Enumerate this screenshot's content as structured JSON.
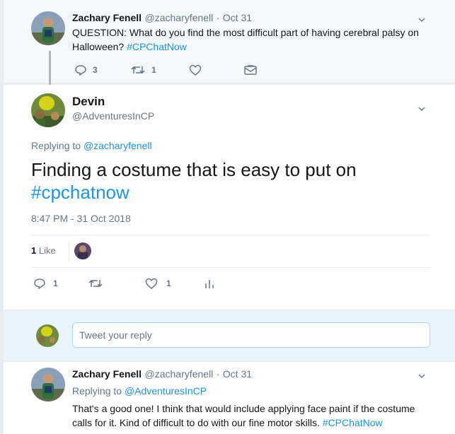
{
  "tweet1": {
    "name": "Zachary Fenell",
    "handle": "@zacharyfenell",
    "dot": "·",
    "date": "Oct 31",
    "text_line1": "QUESTION: What do you find the most difficult part of having cerebral palsy on",
    "text_line2": "Halloween?",
    "hashtag": "#CPChatNow",
    "reply_count": "3",
    "retweet_count": "1"
  },
  "tweet2": {
    "name": "Devin",
    "handle": "@AdventuresInCP",
    "replying_to_label": "Replying to",
    "replying_to_handle": "@zacharyfenell",
    "text_line1": "Finding a costume that is easy to put on",
    "hashtag": "#cpchatnow",
    "timestamp": "8:47 PM - 31 Oct 2018",
    "likes_count": "1",
    "likes_label": "Like",
    "reply_count": "1",
    "like_count": "1"
  },
  "reply_box": {
    "placeholder": "Tweet your reply"
  },
  "tweet3": {
    "name": "Zachary Fenell",
    "handle": "@zacharyfenell",
    "dot": "·",
    "date": "Oct 31",
    "replying_to_label": "Replying to",
    "replying_to_handle": "@AdventuresInCP",
    "text_line1": "That's a good one! I think that would include applying face paint if the costume",
    "text_line2": "calls for it. Kind of difficult to do with our fine motor skills.",
    "hashtag": "#CPChatNow"
  },
  "colors": {
    "link": "#1b95e0",
    "muted": "#657786",
    "text": "#14171a",
    "like_red": "#e0245e"
  },
  "icons": [
    "chevron-down-icon",
    "reply-icon",
    "retweet-icon",
    "heart-icon",
    "dm-icon",
    "analytics-icon"
  ]
}
